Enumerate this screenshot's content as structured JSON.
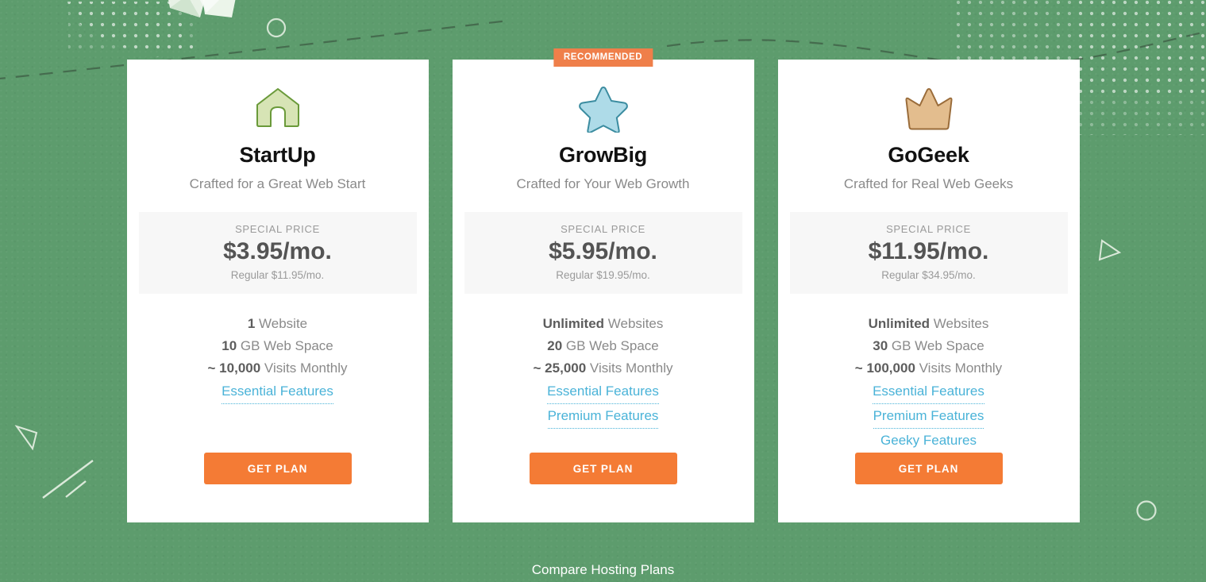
{
  "page": {
    "background_color": "#5d9c6d",
    "accent_orange": "#f47b35",
    "badge_orange": "#ef7f4a",
    "link_blue": "#4ab3d8"
  },
  "plans": [
    {
      "icon": "house-icon",
      "icon_fill": "#d7e4b5",
      "icon_stroke": "#6a9a3a",
      "name": "StartUp",
      "tagline": "Crafted for a Great Web Start",
      "price_label": "SPECIAL PRICE",
      "price": "$3.95/mo.",
      "regular": "Regular $11.95/mo.",
      "recommended": false,
      "badge": "",
      "features": [
        {
          "value": "1",
          "text": " Website"
        },
        {
          "value": "10",
          "text": " GB Web Space"
        },
        {
          "value": "~ 10,000",
          "text": " Visits Monthly"
        }
      ],
      "links": [
        {
          "label": "Essential Features",
          "underlined": true
        }
      ],
      "cta": "GET PLAN"
    },
    {
      "icon": "star-icon",
      "icon_fill": "#aedbe8",
      "icon_stroke": "#3b8ca0",
      "name": "GrowBig",
      "tagline": "Crafted for Your Web Growth",
      "price_label": "SPECIAL PRICE",
      "price": "$5.95/mo.",
      "regular": "Regular $19.95/mo.",
      "recommended": true,
      "badge": "RECOMMENDED",
      "features": [
        {
          "value": "Unlimited",
          "text": " Websites"
        },
        {
          "value": "20",
          "text": " GB Web Space"
        },
        {
          "value": "~ 25,000",
          "text": " Visits Monthly"
        }
      ],
      "links": [
        {
          "label": "Essential Features",
          "underlined": true
        },
        {
          "label": "Premium Features",
          "underlined": true
        }
      ],
      "cta": "GET PLAN"
    },
    {
      "icon": "crown-icon",
      "icon_fill": "#e3bd8e",
      "icon_stroke": "#9a6c3a",
      "name": "GoGeek",
      "tagline": "Crafted for Real Web Geeks",
      "price_label": "SPECIAL PRICE",
      "price": "$11.95/mo.",
      "regular": "Regular $34.95/mo.",
      "recommended": false,
      "badge": "",
      "features": [
        {
          "value": "Unlimited",
          "text": " Websites"
        },
        {
          "value": "30",
          "text": " GB Web Space"
        },
        {
          "value": "~ 100,000",
          "text": " Visits Monthly"
        }
      ],
      "links": [
        {
          "label": "Essential Features",
          "underlined": true
        },
        {
          "label": "Premium Features",
          "underlined": true
        },
        {
          "label": "Geeky Features",
          "underlined": false
        }
      ],
      "cta": "GET PLAN"
    }
  ],
  "footer": {
    "compare_link": "Compare Hosting Plans"
  }
}
